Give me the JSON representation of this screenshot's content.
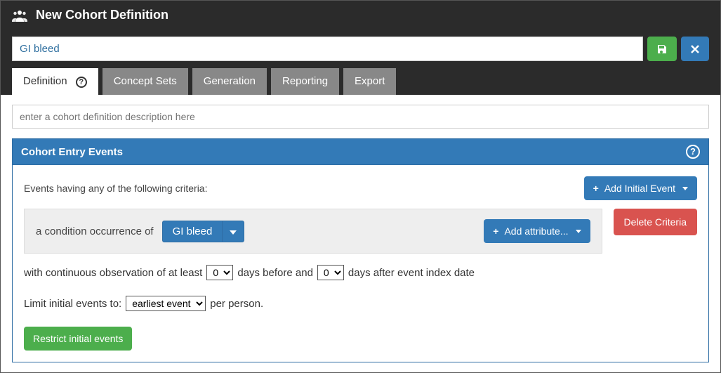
{
  "header": {
    "title": "New Cohort Definition"
  },
  "nameField": {
    "value": "GI bleed"
  },
  "tabs": [
    {
      "label": "Definition",
      "active": true
    },
    {
      "label": "Concept Sets"
    },
    {
      "label": "Generation"
    },
    {
      "label": "Reporting"
    },
    {
      "label": "Export"
    }
  ],
  "description": {
    "placeholder": "enter a cohort definition description here"
  },
  "panel": {
    "title": "Cohort Entry Events",
    "criteriaIntro": "Events having any of the following criteria:",
    "addInitial": "Add Initial Event",
    "conditionPrefix": "a condition occurrence of",
    "conceptSet": "GI bleed",
    "addAttribute": "Add attribute...",
    "deleteCriteria": "Delete Criteria",
    "obsLine": {
      "pre": "with continuous observation of at least",
      "beforeVal": "0",
      "mid": "days before and",
      "afterVal": "0",
      "post": "days after event index date"
    },
    "limitLine": {
      "pre": "Limit initial events to:",
      "select": "earliest event",
      "post": "per person."
    },
    "restrictBtn": "Restrict initial events"
  }
}
